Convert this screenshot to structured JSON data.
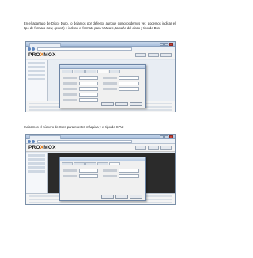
{
  "paragraphs": [
    "En el apartado de Disco Duro, lo dejamos por defecto, aunque como podemos ver, podemos indicar el tipo de formato (raw, qcow2) e incluso el formato para VMware, tamaño del disco y tipo de Bus.",
    "Indicamos el número de Core para nuestra máquina y el tipo de CPU:"
  ],
  "screenshots": [
    {
      "name": "proxmox-hard-disk-dialog",
      "logo_text": "PROXMOX"
    },
    {
      "name": "proxmox-cpu-dialog",
      "logo_text": "PROXMOX"
    }
  ],
  "colors": {
    "logo_accent": "#e57000",
    "window_frame": "#7a8fa8",
    "dialog_frame": "#6c84a4"
  }
}
